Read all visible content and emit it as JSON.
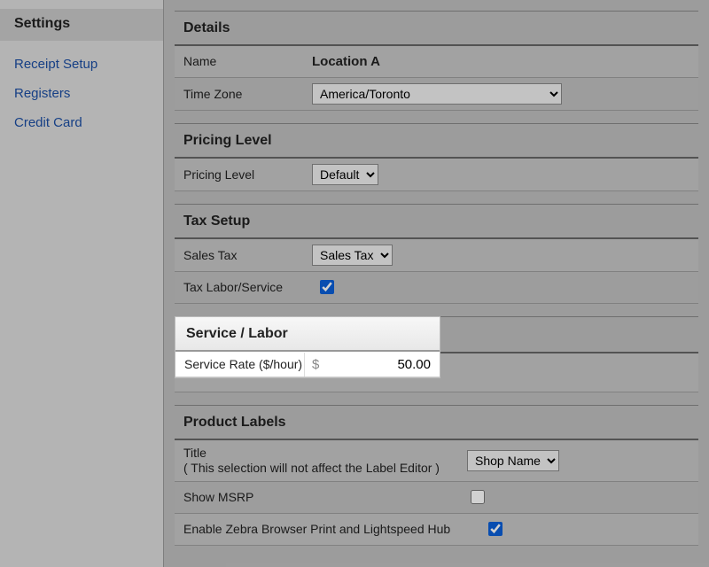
{
  "sidebar": {
    "title": "Settings",
    "items": [
      {
        "label": "Receipt Setup"
      },
      {
        "label": "Registers"
      },
      {
        "label": "Credit Card"
      }
    ]
  },
  "details": {
    "header": "Details",
    "labels": {
      "name": "Name",
      "time_zone": "Time Zone"
    },
    "name": "Location A",
    "time_zone": "America/Toronto"
  },
  "pricing": {
    "header": "Pricing Level",
    "labels": {
      "level": "Pricing Level"
    },
    "level": "Default"
  },
  "tax": {
    "header": "Tax Setup",
    "labels": {
      "sales_tax": "Sales Tax",
      "tax_labor": "Tax Labor/Service"
    },
    "sales_tax": "Sales Tax",
    "tax_labor_checked": true
  },
  "service": {
    "header": "Service / Labor",
    "labels": {
      "rate": "Service Rate ($/hour)",
      "currency": "$"
    },
    "rate": "50.00"
  },
  "product_labels": {
    "header": "Product Labels",
    "labels": {
      "title": "Title",
      "title_note": "( This selection will not affect the Label Editor )",
      "show_msrp": "Show MSRP",
      "enable_zebra": "Enable Zebra Browser Print and Lightspeed Hub"
    },
    "title_value": "Shop Name",
    "show_msrp_checked": false,
    "enable_zebra_checked": true
  }
}
